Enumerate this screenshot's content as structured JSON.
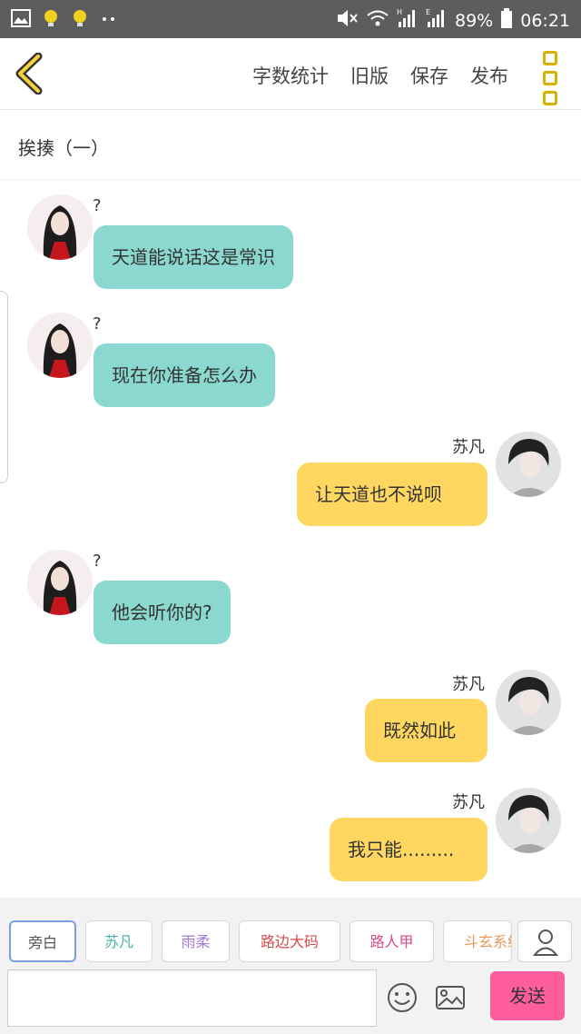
{
  "status_bar": {
    "left_icons": [
      "image-icon",
      "bulb-icon",
      "bulb-icon",
      "dots-icon"
    ],
    "right_icons": [
      "mute-icon",
      "wifi-icon",
      "signal-icon",
      "signal-icon"
    ],
    "signal_labels": [
      "H",
      "E"
    ],
    "battery": "89%",
    "time": "06:21"
  },
  "topbar": {
    "word_count": "字数统计",
    "old_version": "旧版",
    "save": "保存",
    "publish": "发布"
  },
  "chapter_title": "挨揍（一）",
  "messages": [
    {
      "side": "left",
      "sender": "?",
      "text": "天道能说话这是常识"
    },
    {
      "side": "left",
      "sender": "?",
      "text": "现在你准备怎么办"
    },
    {
      "side": "right",
      "sender": "苏凡",
      "text": "让天道也不说呗"
    },
    {
      "side": "left",
      "sender": "?",
      "text": "他会听你的?"
    },
    {
      "side": "right",
      "sender": "苏凡",
      "text": "既然如此"
    },
    {
      "side": "right",
      "sender": "苏凡",
      "text": "我只能........."
    }
  ],
  "role_chips": [
    {
      "label": "旁白",
      "color": "#555555"
    },
    {
      "label": "苏凡",
      "color": "#49b3a6"
    },
    {
      "label": "雨柔",
      "color": "#a57bd6"
    },
    {
      "label": "路边大码",
      "color": "#d94b4b"
    },
    {
      "label": "路人甲",
      "color": "#d94b8a"
    },
    {
      "label": "斗玄系统",
      "color": "#e69a5c"
    }
  ],
  "send_label": "发送",
  "colors": {
    "teal_bubble": "#8ad8cf",
    "yellow_bubble": "#ffd760",
    "send_button": "#ff5e9c",
    "menu_accent": "#d9b100"
  }
}
